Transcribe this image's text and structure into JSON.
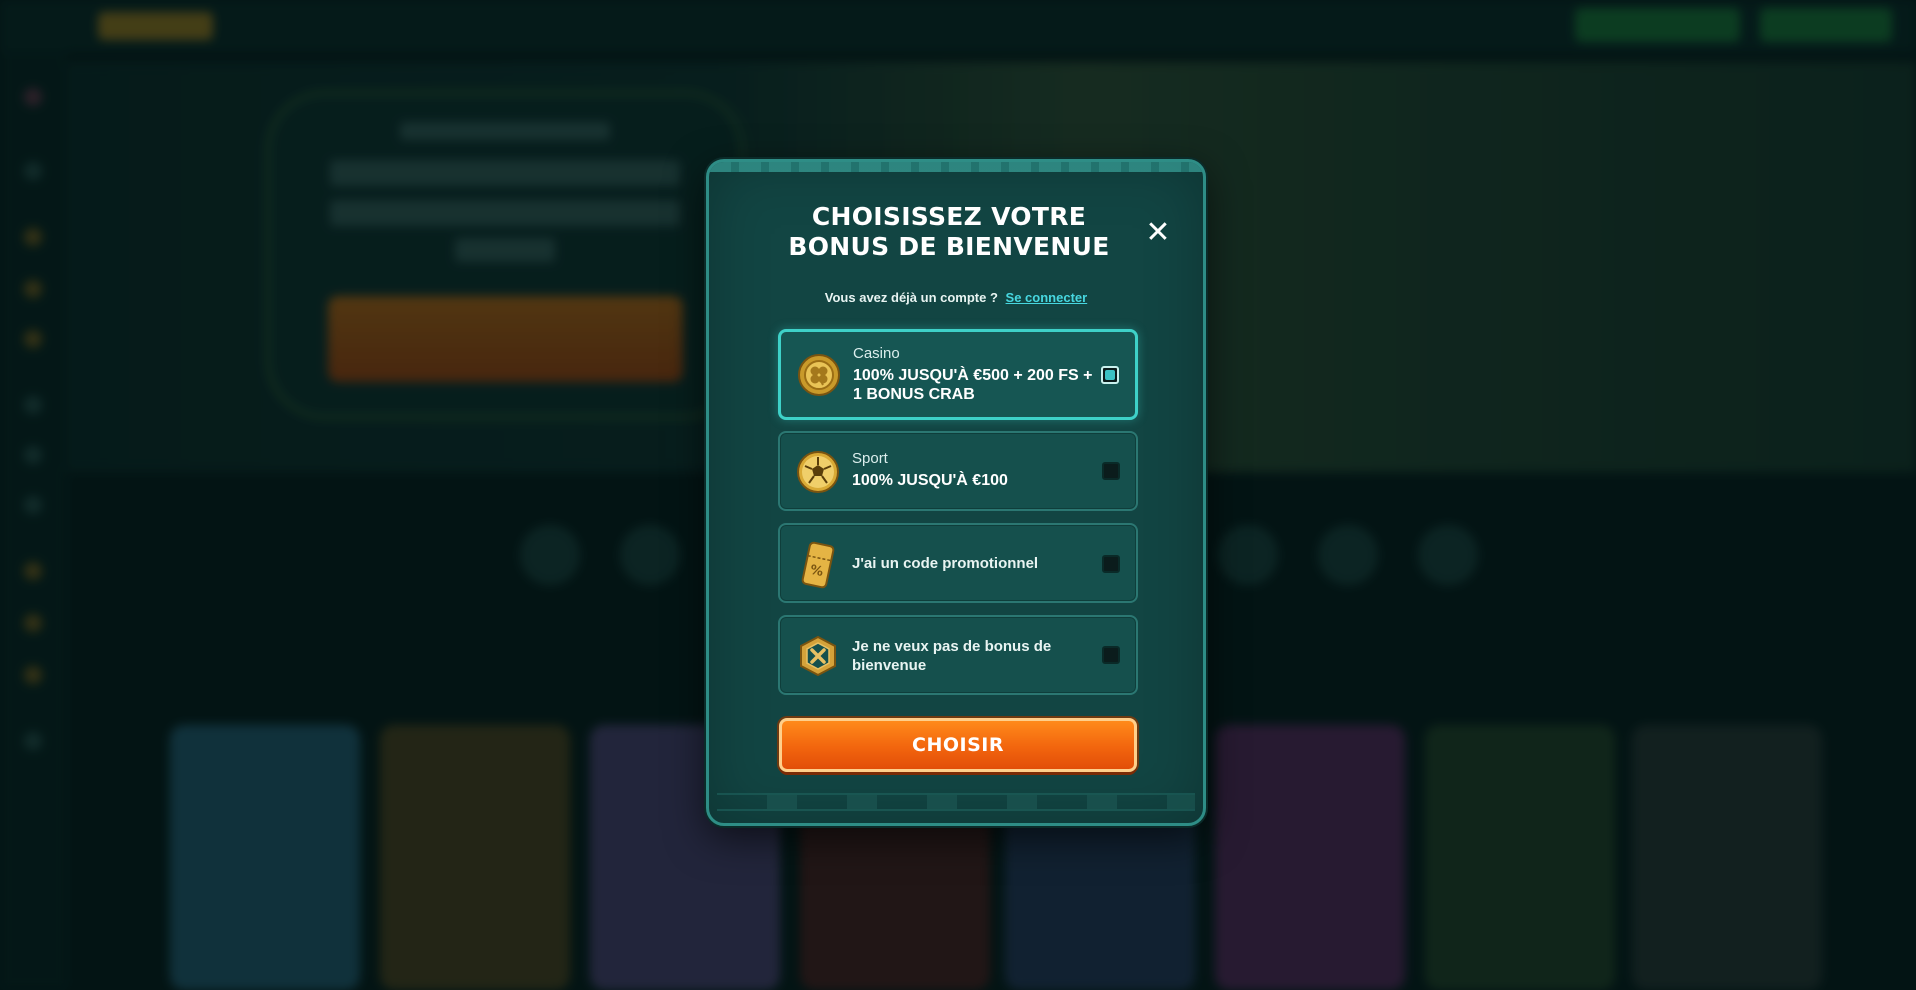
{
  "modal": {
    "title": "CHOISISSEZ VOTRE BONUS DE BIENVENUE",
    "close_icon": "close-icon",
    "account_prompt": "Vous avez déjà un compte ?",
    "login_link": "Se connecter",
    "options": [
      {
        "category": "Casino",
        "value": "100% JUSQU'À €500 + 200 FS + 1 BONUS CRAB",
        "icon": "clover-coin-icon",
        "selected": true
      },
      {
        "category": "Sport",
        "value": "100% JUSQU'À €100",
        "icon": "soccer-ball-icon",
        "selected": false
      },
      {
        "label": "J'ai un code promotionnel",
        "icon": "promo-ticket-icon",
        "selected": false
      },
      {
        "label": "Je ne veux pas de bonus de bienvenue",
        "icon": "no-bonus-icon",
        "selected": false
      }
    ],
    "choose_button": "CHOISIR"
  },
  "colors": {
    "modal_bg": "#124543",
    "selected_border": "#3ed1c8",
    "link": "#47d7e0",
    "button_orange": "#f2650e"
  }
}
